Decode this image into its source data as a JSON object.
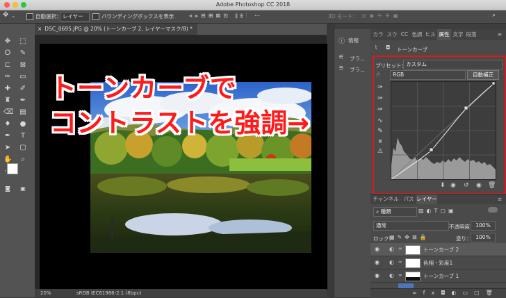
{
  "window": {
    "title": "Adobe Photoshop CC 2018"
  },
  "options_bar": {
    "auto_select_label": "自動選択：",
    "auto_select_value": "レイヤー",
    "transform_label": "バウンディングボックスを表示",
    "mode_3d": "3D モード："
  },
  "document": {
    "tab_title": "DSC_0695.JPG @ 20% (トーンカーブ 2, レイヤーマスク/8) *",
    "zoom": "20%",
    "color_profile": "sRGB IEC61966-2.1 (8bpc)"
  },
  "overlay": {
    "line1": "トーンカーブで",
    "line2": "コントラストを強調→"
  },
  "narrow_panel": {
    "info_label": "情報",
    "item1": "ブラ...",
    "item2": "ブラ..."
  },
  "panel_tabs": [
    "カラ",
    "スウ",
    "CC",
    "色調",
    "ヒス",
    "属性",
    "文字",
    "段落"
  ],
  "active_panel_tab": "属性",
  "properties": {
    "header": "トーンカーブ",
    "preset_label": "プリセット：",
    "preset_value": "カスタム",
    "channel": "RGB",
    "auto_button": "自動補正"
  },
  "layers_panel": {
    "tabs": [
      "チャンネル",
      "パス",
      "レイヤー"
    ],
    "active_tab": "レイヤー",
    "filter_label": "種類",
    "blend_mode": "通常",
    "opacity_label": "不透明度：",
    "opacity_value": "100%",
    "lock_label": "ロック：",
    "fill_label": "塗り：",
    "fill_value": "100%",
    "layers": [
      {
        "name": "トーンカーブ 2"
      },
      {
        "name": "色相・彩度1"
      },
      {
        "name": "トーンカーブ 1"
      }
    ]
  },
  "colors": {
    "accent_red": "#e01818",
    "overlay_text": "#ff1a1a"
  },
  "icons": [
    "move-icon",
    "marquee-icon",
    "lasso-icon",
    "crop-icon",
    "eyedropper-icon",
    "brush-icon",
    "eraser-icon",
    "gradient-icon",
    "pen-icon",
    "type-icon",
    "hand-icon",
    "zoom-icon",
    "eye-icon",
    "link-icon",
    "trash-icon"
  ]
}
